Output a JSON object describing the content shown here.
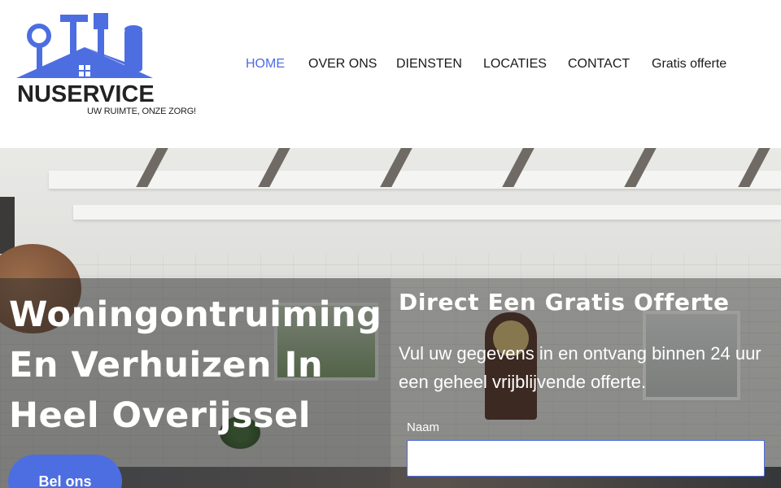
{
  "brand": {
    "name": "NUSERVICE",
    "tagline": "UW RUIMTE, ONZE ZORG!",
    "accent": "#4d6ee0"
  },
  "nav": {
    "items": [
      {
        "label": "HOME",
        "active": true
      },
      {
        "label": "OVER ONS",
        "active": false
      },
      {
        "label": "DIENSTEN",
        "active": false
      },
      {
        "label": "LOCATIES",
        "active": false
      },
      {
        "label": "CONTACT",
        "active": false
      },
      {
        "label": "Gratis offerte",
        "active": false
      }
    ]
  },
  "hero": {
    "title_line1": "Woningontruiming",
    "title_line2": "En Verhuizen In",
    "title_line3": "Heel Overijssel",
    "cta_label": "Bel ons"
  },
  "form": {
    "title": "Direct Een Gratis Offerte",
    "description": "Vul uw gegevens in en ontvang binnen 24 uur een geheel vrijblijvende offerte.",
    "name_label": "Naam",
    "name_value": ""
  }
}
